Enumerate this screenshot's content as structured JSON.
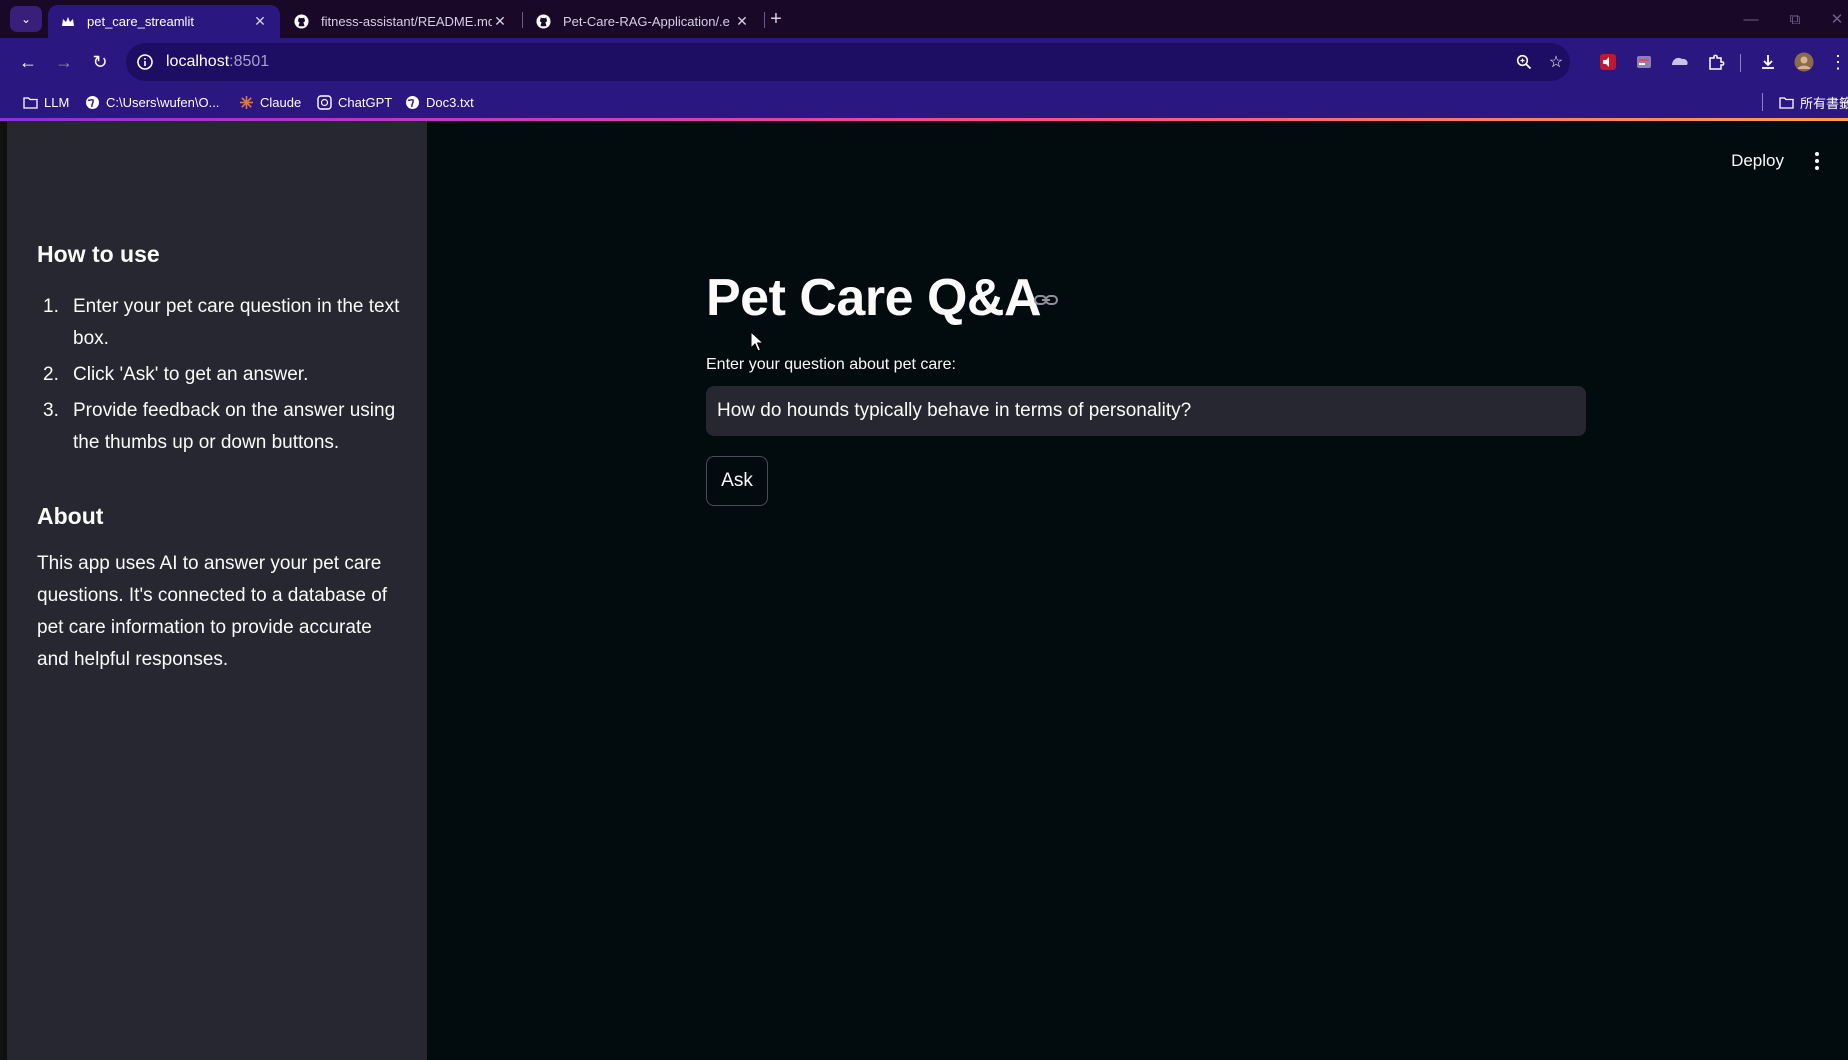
{
  "browser": {
    "tabs": [
      {
        "title": "pet_care_streamlit",
        "active": true
      },
      {
        "title": "fitness-assistant/README.md",
        "active": false
      },
      {
        "title": "Pet-Care-RAG-Application/.e",
        "active": false
      }
    ],
    "new_tab_symbol": "+",
    "address": {
      "host": "localhost",
      "port": ":8501"
    },
    "bookmarks": [
      {
        "label": "LLM",
        "icon": "folder-icon"
      },
      {
        "label": "C:\\Users\\wufen\\O...",
        "icon": "globe-icon"
      },
      {
        "label": "Claude",
        "icon": "claude-icon"
      },
      {
        "label": "ChatGPT",
        "icon": "chatgpt-icon"
      },
      {
        "label": "Doc3.txt",
        "icon": "globe-icon"
      }
    ],
    "all_bookmarks_label": "所有書籤",
    "accent_colors": [
      "#8e2de2",
      "#ff4b8b",
      "#ff9f43"
    ]
  },
  "sidebar": {
    "how_to_use_heading": "How to use",
    "steps": [
      {
        "num": "1.",
        "text": "Enter your pet care question in the text box."
      },
      {
        "num": "2.",
        "text": "Click 'Ask' to get an answer."
      },
      {
        "num": "3.",
        "text": "Provide feedback on the answer using the thumbs up or down buttons."
      }
    ],
    "about_heading": "About",
    "about_text": "This app uses AI to answer your pet care questions. It's connected to a database of pet care information to provide accurate and helpful responses."
  },
  "main": {
    "deploy_label": "Deploy",
    "title": "Pet Care Q&A",
    "question_label": "Enter your question about pet care:",
    "question_value": "How do hounds typically behave in terms of personality?",
    "ask_label": "Ask"
  }
}
